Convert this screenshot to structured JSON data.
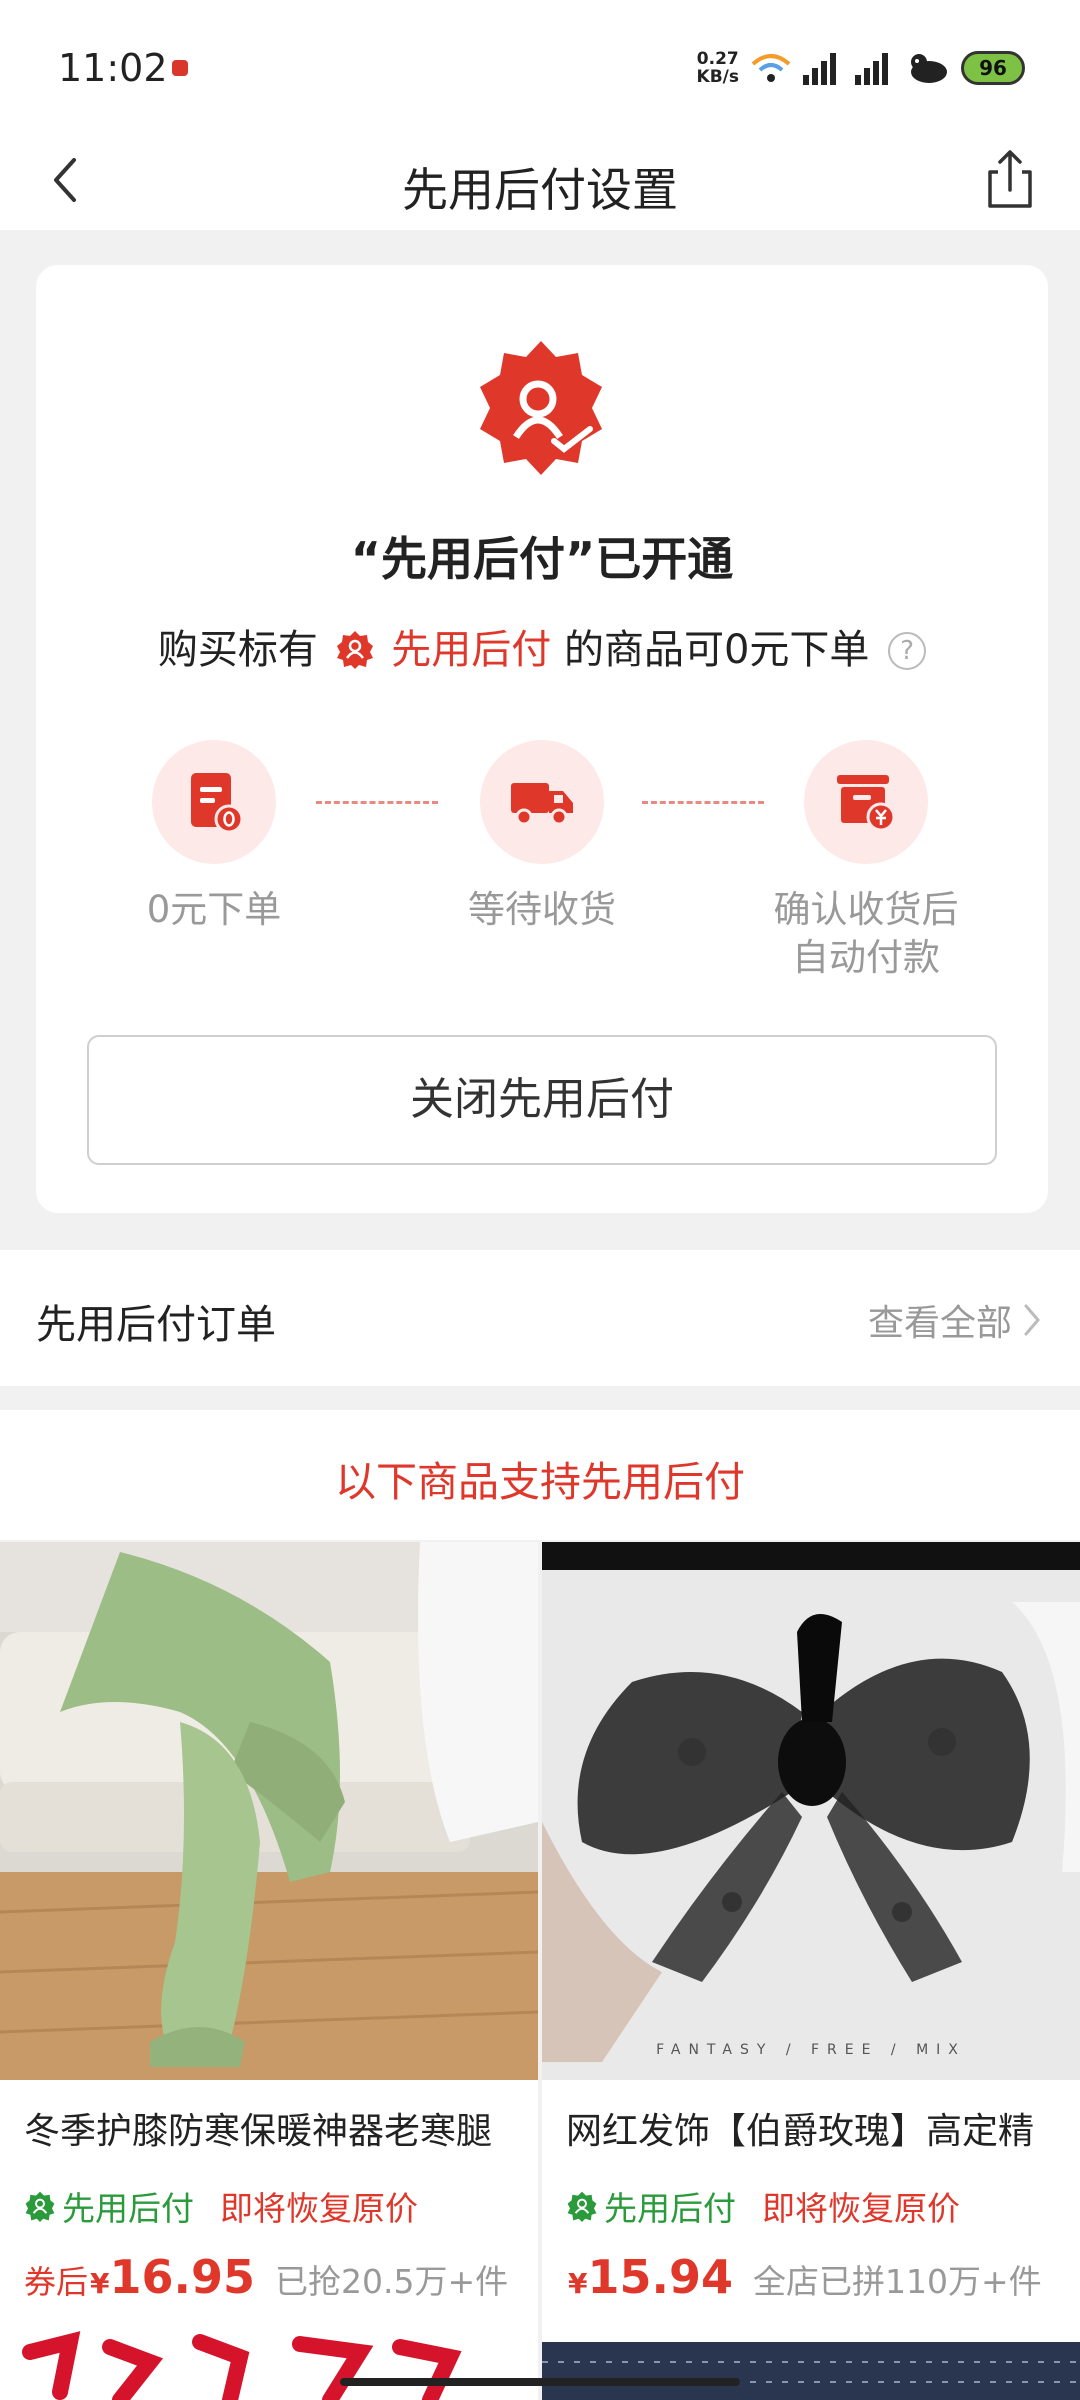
{
  "status_bar": {
    "time": "11:02",
    "net_speed_value": "0.27",
    "net_speed_unit": "KB/s",
    "battery": "96"
  },
  "nav": {
    "title": "先用后付设置"
  },
  "activation_card": {
    "title": "“先用后付”已开通",
    "subtitle_before": "购买标有",
    "subtitle_highlight": "先用后付",
    "subtitle_after": "的商品可0元下单",
    "help_symbol": "?",
    "steps": [
      {
        "label": "0元下单",
        "icon": "order-zero-icon"
      },
      {
        "label": "等待收货",
        "icon": "delivery-truck-icon"
      },
      {
        "label": "确认收货后\n自动付款",
        "icon": "auto-pay-icon"
      }
    ],
    "close_button": "关闭先用后付",
    "accent_color": "#e0372b"
  },
  "orders": {
    "title": "先用后付订单",
    "view_all": "查看全部"
  },
  "support_section": {
    "title": "以下商品支持先用后付"
  },
  "products": [
    {
      "name": "冬季护膝防寒保暖神器老寒腿",
      "tag_green": "先用后付",
      "tag_red": "即将恢复原价",
      "price_prefix": "券后",
      "currency": "¥",
      "price": "16.95",
      "sold": "已抢20.5万+件",
      "image": "green-fleece-leg-warmers"
    },
    {
      "name": "网红发饰【伯爵玫瑰】高定精",
      "tag_green": "先用后付",
      "tag_red": "即将恢复原价",
      "price_prefix": "",
      "currency": "¥",
      "price": "15.94",
      "sold": "全店已拼110万+件",
      "image": "black-lace-bow-hair-clip",
      "image_caption": "FANTASY  /  FREE  /  MIX"
    }
  ]
}
